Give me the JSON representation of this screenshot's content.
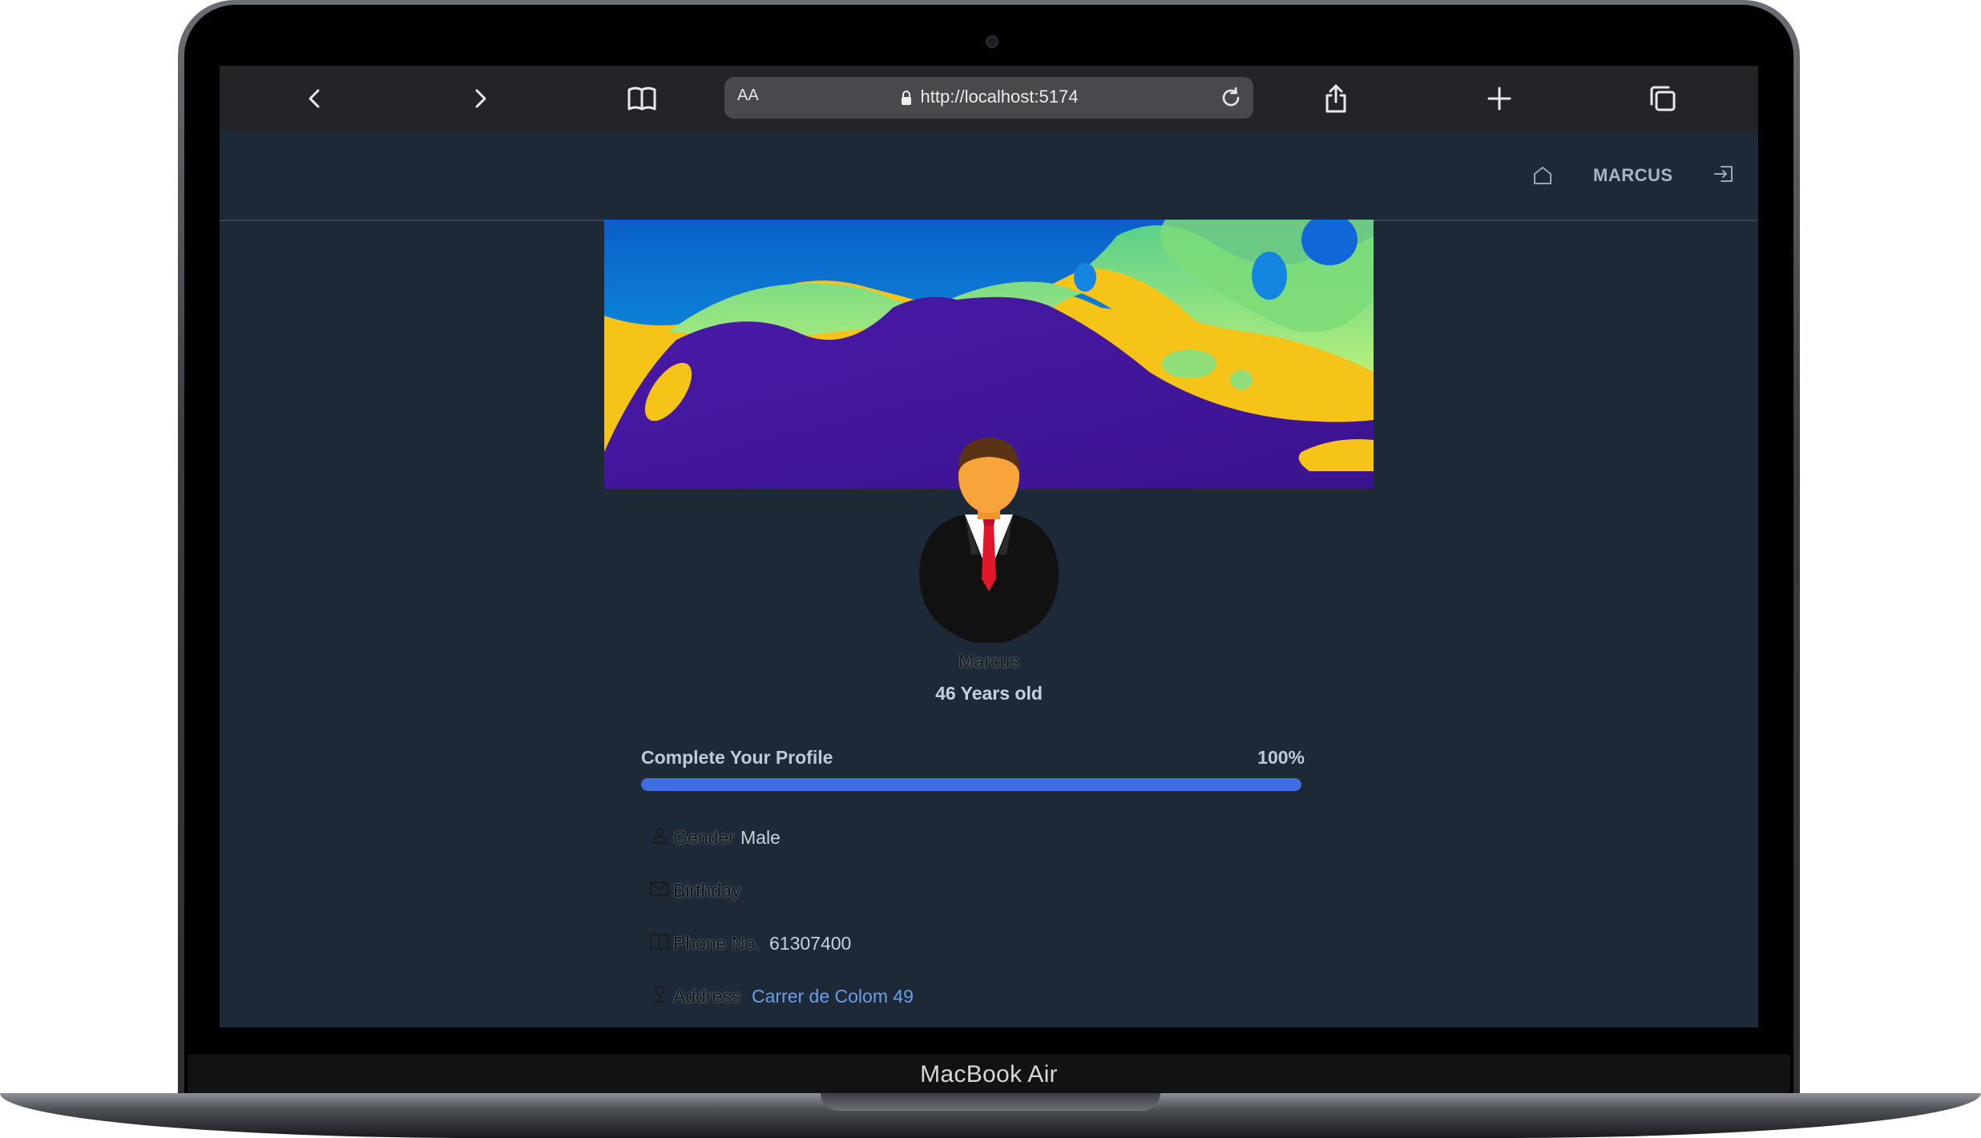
{
  "device": {
    "label": "MacBook Air"
  },
  "browser": {
    "text_size_label": "AA",
    "url": "http://localhost:5174"
  },
  "nav": {
    "username": "MARCUS"
  },
  "profile": {
    "name": "Marcus",
    "age_text": "46 Years old",
    "progress": {
      "label": "Complete Your Profile",
      "percent_text": "100%",
      "value": 1.0
    },
    "fields": [
      {
        "label": "Gender",
        "value": "Male",
        "icon": "person-icon"
      },
      {
        "label": "Birthday",
        "value": "",
        "icon": "envelope-icon"
      },
      {
        "label": "Phone No.",
        "value": "61307400",
        "icon": "book-icon"
      },
      {
        "label": "Address",
        "value": "Carrer de Colom 49",
        "icon": "pin-icon"
      }
    ]
  },
  "colors": {
    "page_bg": "#1e2937",
    "accent": "#3f6de0",
    "link": "#6a9ee8"
  }
}
